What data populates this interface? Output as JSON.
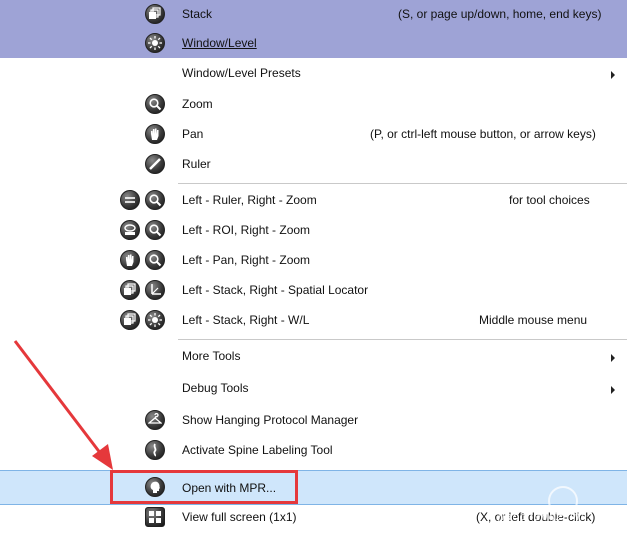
{
  "items": {
    "stack": {
      "label": "Stack",
      "hint": "(S, or page up/down, home, end keys)"
    },
    "window_level": {
      "label": "Window/Level"
    },
    "window_level_presets": {
      "label": "Window/Level Presets"
    },
    "zoom": {
      "label": "Zoom"
    },
    "pan": {
      "label": "Pan",
      "hint": "(P, or ctrl-left mouse button, or arrow keys)"
    },
    "ruler": {
      "label": "Ruler"
    },
    "left_ruler_right_zoom": {
      "label": "Left - Ruler, Right - Zoom",
      "hint": "for tool choices"
    },
    "left_roi_right_zoom": {
      "label": "Left - ROI, Right - Zoom"
    },
    "left_pan_right_zoom": {
      "label": "Left - Pan, Right - Zoom"
    },
    "left_stack_right_locator": {
      "label": "Left - Stack, Right - Spatial Locator"
    },
    "left_stack_right_wl": {
      "label": "Left - Stack, Right - W/L",
      "hint": "Middle mouse menu"
    },
    "more_tools": {
      "label": "More Tools"
    },
    "debug_tools": {
      "label": "Debug Tools"
    },
    "show_hanging": {
      "label": "Show Hanging Protocol Manager"
    },
    "spine_labeling": {
      "label": "Activate Spine Labeling Tool"
    },
    "open_mpr": {
      "label": "Open with MPR..."
    },
    "full_screen": {
      "label": "View full screen (1x1)",
      "hint": "(X, or left double-click)"
    }
  },
  "watermark": {
    "text": "jiaochengzhijia"
  },
  "colors": {
    "highlight_top": "#9ea3d6",
    "highlight_mpr": "#cfe6fb",
    "annotation_red": "#e5383b"
  }
}
